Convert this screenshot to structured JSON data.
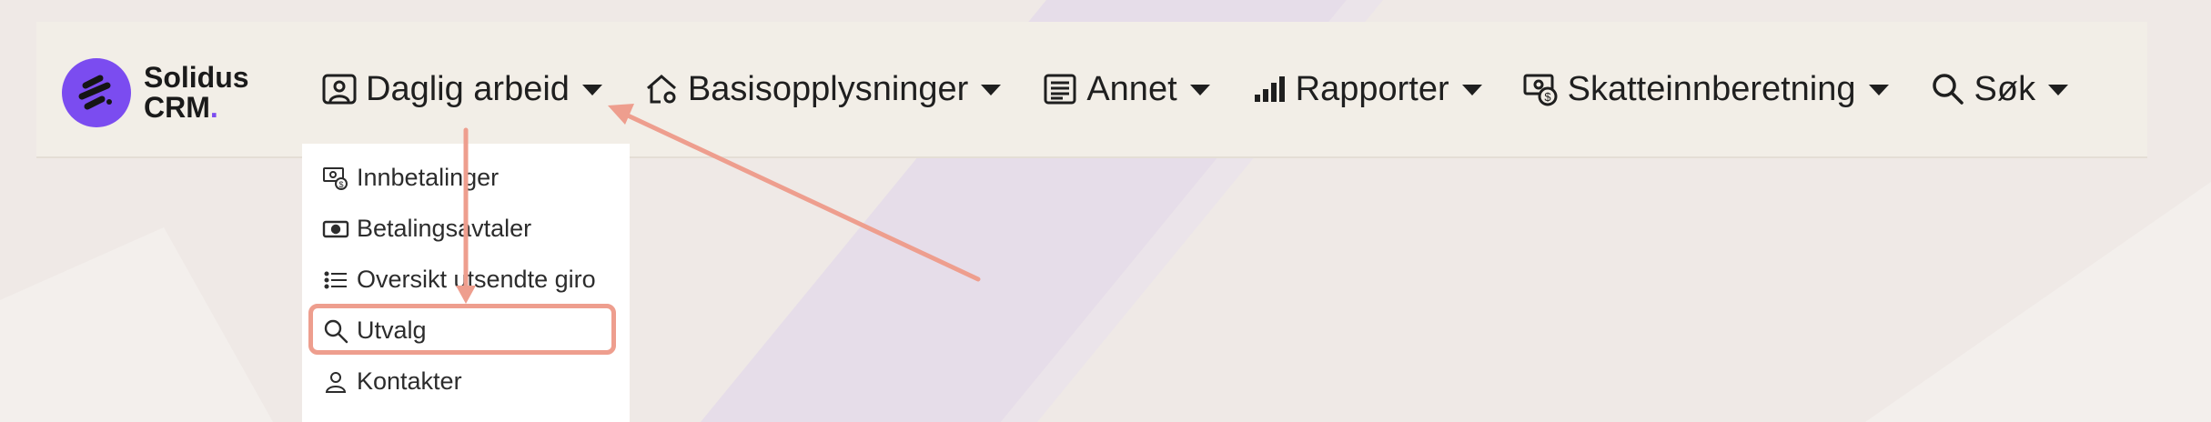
{
  "brand": {
    "name_line1": "Solidus",
    "name_line2": "CRM",
    "name_dot": "."
  },
  "nav": {
    "items": [
      {
        "label": "Daglig arbeid",
        "icon": "person-badge-icon"
      },
      {
        "label": "Basisopplysninger",
        "icon": "house-gear-icon"
      },
      {
        "label": "Annet",
        "icon": "newspaper-icon"
      },
      {
        "label": "Rapporter",
        "icon": "bar-chart-icon"
      },
      {
        "label": "Skatteinnberetning",
        "icon": "cash-coin-icon"
      },
      {
        "label": "Søk",
        "icon": "search-icon"
      }
    ]
  },
  "dropdown": {
    "items": [
      {
        "label": "Innbetalinger",
        "icon": "cash-coin-icon"
      },
      {
        "label": "Betalingsavtaler",
        "icon": "cash-icon"
      },
      {
        "label": "Oversikt utsendte giro",
        "icon": "list-icon"
      },
      {
        "label": "Utvalg",
        "icon": "search-icon",
        "highlighted": true
      },
      {
        "label": "Kontakter",
        "icon": "person-icon"
      }
    ]
  },
  "colors": {
    "background": "#efe9e6",
    "navbar": "#f2eee7",
    "brand_purple": "#7b4cf0",
    "annotation": "#ee9e8e",
    "dropdown_bg": "#ffffff"
  }
}
